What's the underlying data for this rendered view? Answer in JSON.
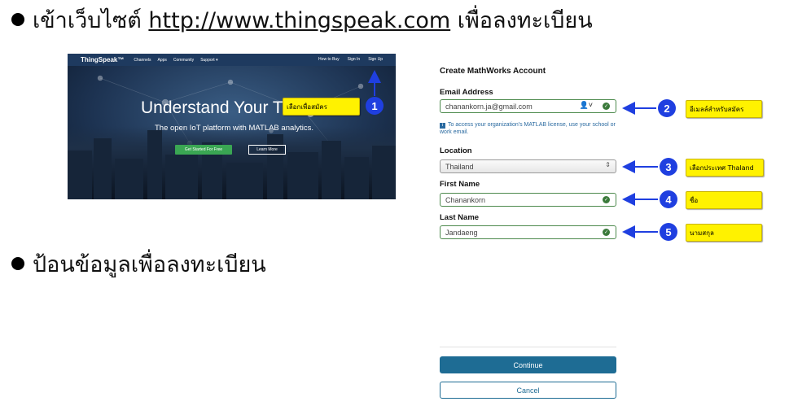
{
  "slide": {
    "bullet1_text": "เข้าเว็บไซต์",
    "bullet1_link": "http://www.thingspeak.com",
    "bullet1_tail": "เพื่อลงทะเบียน",
    "bullet2_text": "ป้อนข้อมูลเพื่อลงทะเบียน"
  },
  "thingspeak": {
    "logo": "ThingSpeak™",
    "nav": [
      "Channels",
      "Apps",
      "Community",
      "Support ▾"
    ],
    "nav_right": [
      "How to Buy",
      "Sign In",
      "Sign Up"
    ],
    "hero_title": "Understand Your Things",
    "hero_subtitle": "The open IoT platform with MATLAB analytics.",
    "btn_primary": "Get Started For Free",
    "btn_secondary": "Learn More"
  },
  "form": {
    "title": "Create MathWorks Account",
    "email_label": "Email Address",
    "email_value": "chanankorn.ja@gmail.com",
    "hint": "To access your organization's MATLAB license, use your school or work email.",
    "location_label": "Location",
    "location_value": "Thailand",
    "first_label": "First Name",
    "first_value": "Chanankorn",
    "last_label": "Last Name",
    "last_value": "Jandaeng",
    "continue": "Continue",
    "cancel": "Cancel"
  },
  "annotations": {
    "n1": "1",
    "c1": "เลือกเพื่อสมัคร",
    "n2": "2",
    "c2": "อีเมลล์สำหรับสมัคร",
    "n3": "3",
    "c3": "เลือกประเทศ Thaland",
    "n4": "4",
    "c4": "ชื่อ",
    "n5": "5",
    "c5": "นามสกุล"
  },
  "colors": {
    "accent_blue": "#1f3fe0",
    "callout_yellow": "#fff200",
    "button_teal": "#1e6c94"
  }
}
